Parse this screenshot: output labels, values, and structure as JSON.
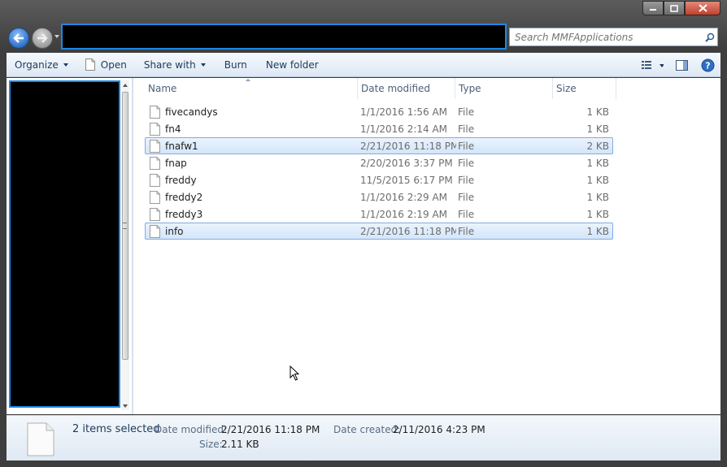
{
  "window": {
    "search_placeholder": "Search MMFApplications"
  },
  "toolbar": {
    "organize": "Organize",
    "open": "Open",
    "share_with": "Share with",
    "burn": "Burn",
    "new_folder": "New folder"
  },
  "columns": {
    "name": "Name",
    "date_modified": "Date modified",
    "type": "Type",
    "size": "Size"
  },
  "files": [
    {
      "name": "fivecandys",
      "date": "1/1/2016 1:56 AM",
      "type": "File",
      "size": "1 KB",
      "selected": false
    },
    {
      "name": "fn4",
      "date": "1/1/2016 2:14 AM",
      "type": "File",
      "size": "1 KB",
      "selected": false
    },
    {
      "name": "fnafw1",
      "date": "2/21/2016 11:18 PM",
      "type": "File",
      "size": "2 KB",
      "selected": true
    },
    {
      "name": "fnap",
      "date": "2/20/2016 3:37 PM",
      "type": "File",
      "size": "1 KB",
      "selected": false
    },
    {
      "name": "freddy",
      "date": "11/5/2015 6:17 PM",
      "type": "File",
      "size": "1 KB",
      "selected": false
    },
    {
      "name": "freddy2",
      "date": "1/1/2016 2:29 AM",
      "type": "File",
      "size": "1 KB",
      "selected": false
    },
    {
      "name": "freddy3",
      "date": "1/1/2016 2:19 AM",
      "type": "File",
      "size": "1 KB",
      "selected": false
    },
    {
      "name": "info",
      "date": "2/21/2016 11:18 PM",
      "type": "File",
      "size": "1 KB",
      "selected": true
    }
  ],
  "details": {
    "selection_count": "2 items selected",
    "date_modified_label": "Date modified:",
    "date_modified_value": "2/21/2016 11:18 PM",
    "date_created_label": "Date created:",
    "date_created_value": "2/11/2016 4:23 PM",
    "size_label": "Size:",
    "size_value": "2.11 KB"
  },
  "colors": {
    "accent": "#1e88e5",
    "selection_border": "#84acdd",
    "toolbar_text": "#1e395b"
  }
}
